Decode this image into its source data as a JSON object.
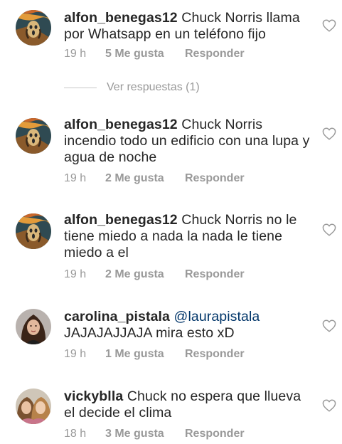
{
  "comments": [
    {
      "username": "alfon_benegas12",
      "mention": "",
      "text": "Chuck Norris llama por Whatsapp en un teléfono fijo",
      "time": "19 h",
      "likes": "5 Me gusta",
      "reply": "Responder",
      "avatar": "scream-painting-avatar"
    },
    {
      "username": "alfon_benegas12",
      "mention": "",
      "text": "Chuck Norris incendio todo un edificio con una lupa y agua de noche",
      "time": "19 h",
      "likes": "2 Me gusta",
      "reply": "Responder",
      "avatar": "scream-painting-avatar"
    },
    {
      "username": "alfon_benegas12",
      "mention": "",
      "text": "Chuck Norris no le tiene miedo a nada la nada le tiene miedo a el",
      "time": "19 h",
      "likes": "2 Me gusta",
      "reply": "Responder",
      "avatar": "scream-painting-avatar"
    },
    {
      "username": "carolina_pistala",
      "mention": "@laurapistala",
      "text": "JAJAJAJJAJA mira esto xD",
      "time": "19 h",
      "likes": "1 Me gusta",
      "reply": "Responder",
      "avatar": "woman-portrait-avatar"
    },
    {
      "username": "vickyblla",
      "mention": "",
      "text": "Chuck no espera que llueva el decide el clima",
      "time": "18 h",
      "likes": "3 Me gusta",
      "reply": "Responder",
      "avatar": "two-women-selfie-avatar"
    }
  ],
  "view_replies": "Ver respuestas (1)",
  "colors": {
    "text": "#262626",
    "muted": "#999999",
    "mention": "#003569"
  }
}
